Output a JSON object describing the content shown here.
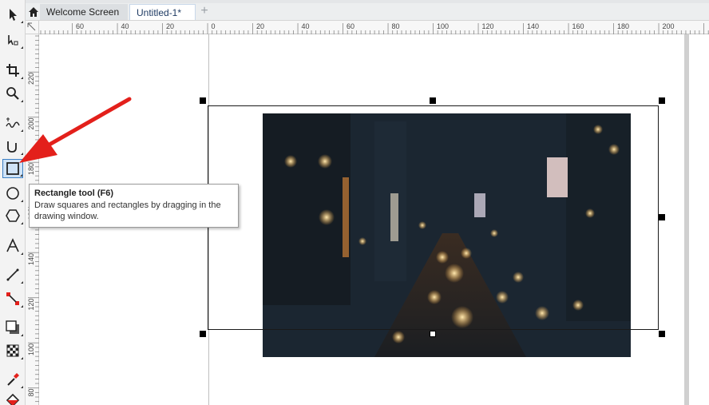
{
  "tabs": {
    "home_icon": "home-icon",
    "items": [
      {
        "label": "Welcome Screen"
      },
      {
        "label": "Untitled-1*"
      }
    ],
    "add_label": "+"
  },
  "toolbox": {
    "tools": [
      {
        "name": "pick-tool",
        "icon": "arrow-pointer-icon"
      },
      {
        "name": "shape-tool",
        "icon": "shape-node-icon"
      },
      {
        "name": "crop-tool",
        "icon": "crop-icon"
      },
      {
        "name": "zoom-tool",
        "icon": "magnifier-icon"
      },
      {
        "name": "freehand-tool",
        "icon": "freehand-icon"
      },
      {
        "name": "artistic-media-tool",
        "icon": "curve-icon"
      },
      {
        "name": "rectangle-tool",
        "icon": "rectangle-icon",
        "active": true
      },
      {
        "name": "ellipse-tool",
        "icon": "ellipse-icon"
      },
      {
        "name": "polygon-tool",
        "icon": "polygon-icon"
      },
      {
        "name": "text-tool",
        "icon": "text-a-icon"
      },
      {
        "name": "dimension-tool",
        "icon": "parallel-dimension-icon"
      },
      {
        "name": "connector-tool",
        "icon": "connector-icon"
      },
      {
        "name": "drop-shadow-tool",
        "icon": "drop-shadow-icon"
      },
      {
        "name": "transparency-tool",
        "icon": "checkerboard-icon"
      },
      {
        "name": "eyedropper-tool",
        "icon": "eyedropper-icon"
      },
      {
        "name": "interactive-fill-tool",
        "icon": "fill-bucket-icon"
      }
    ]
  },
  "rulers": {
    "horizontal_labels": [
      "60",
      "40",
      "20",
      "0",
      "20",
      "40",
      "60",
      "80",
      "100",
      "120",
      "140",
      "160",
      "180",
      "200"
    ],
    "vertical_labels": [
      "220",
      "200",
      "180",
      "160",
      "140",
      "120",
      "100",
      "80"
    ]
  },
  "tooltip": {
    "title": "Rectangle tool (F6)",
    "description": "Draw squares and rectangles by dragging in the drawing window."
  },
  "canvas": {
    "image_description_icon": "city-night-photo"
  },
  "colors": {
    "arrow": "#e3201b",
    "active_tool": "#cfe3f7",
    "tab_active_text": "#1f3b63"
  }
}
